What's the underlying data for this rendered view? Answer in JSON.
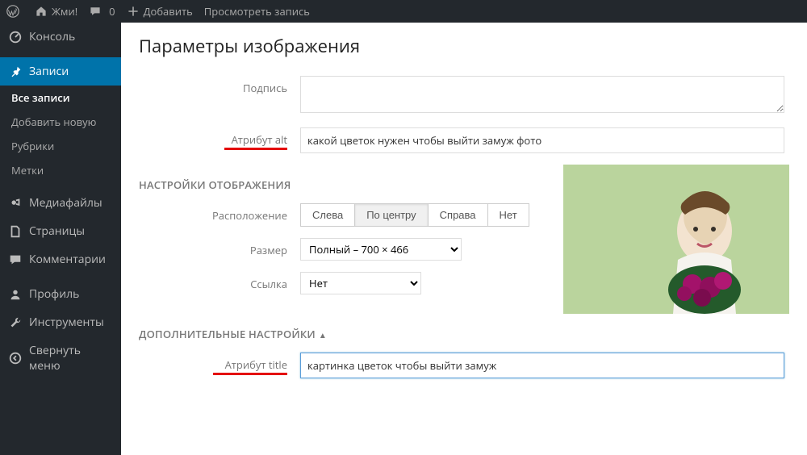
{
  "topbar": {
    "site_name": "Жми!",
    "comments": "0",
    "add_new": "Добавить",
    "view_post": "Просмотреть запись"
  },
  "sidebar": {
    "console": "Консоль",
    "posts": "Записи",
    "sub": {
      "all": "Все записи",
      "add": "Добавить новую",
      "cats": "Рубрики",
      "tags": "Метки"
    },
    "media": "Медиафайлы",
    "pages": "Страницы",
    "comments": "Комментарии",
    "profile": "Профиль",
    "tools": "Инструменты",
    "collapse": "Свернуть меню"
  },
  "panel": {
    "title": "Параметры изображения",
    "labels": {
      "caption": "Подпись",
      "alt": "Атрибут alt",
      "align": "Расположение",
      "size": "Размер",
      "link": "Ссылка",
      "title_attr": "Атрибут title"
    },
    "sections": {
      "display": "НАСТРОЙКИ ОТОБРАЖЕНИЯ",
      "advanced": "ДОПОЛНИТЕЛЬНЫЕ НАСТРОЙКИ"
    },
    "values": {
      "caption": "",
      "alt": "какой цветок нужен чтобы выйти замуж фото",
      "size_selected": "Полный – 700 × 466",
      "link_selected": "Нет",
      "title_attr": "картинка цветок чтобы выйти замуж"
    },
    "align_options": {
      "left": "Слева",
      "center": "По центру",
      "right": "Справа",
      "none": "Нет"
    }
  }
}
